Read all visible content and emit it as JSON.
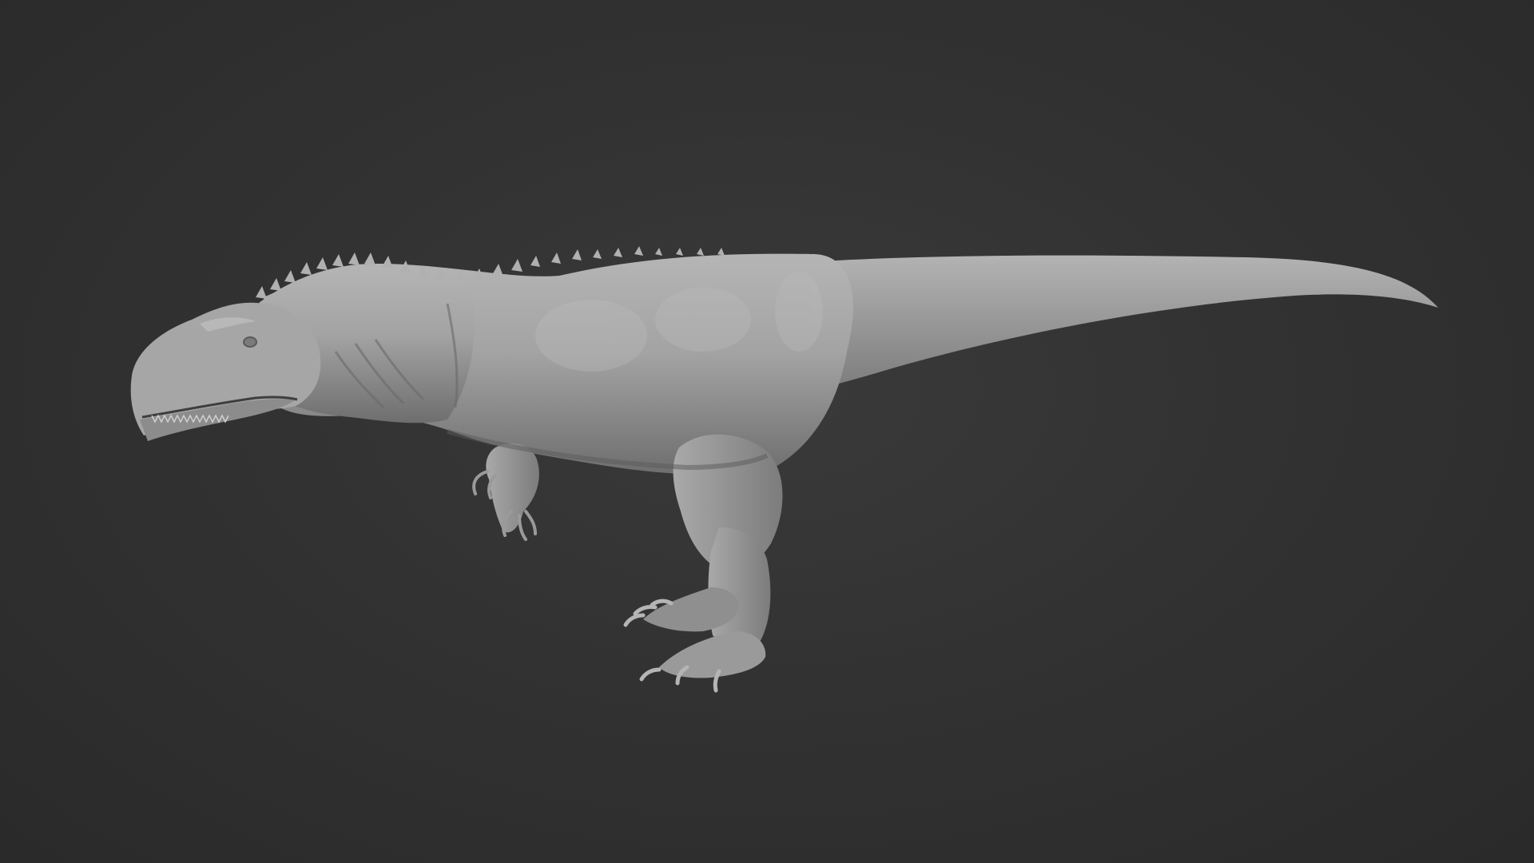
{
  "scene": {
    "subject": "dinosaur-sculpt",
    "background_color": "#303030",
    "model_color": "#9a9a9a",
    "shadow_color": "#4a4a4a"
  }
}
